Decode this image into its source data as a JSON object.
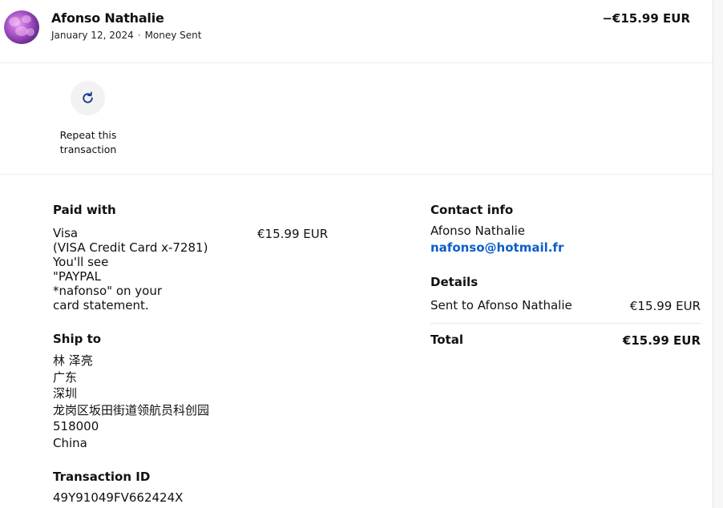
{
  "header": {
    "name": "Afonso Nathalie",
    "date": "January 12, 2024",
    "separator": "·",
    "type": "Money Sent",
    "amount": "−€15.99 EUR"
  },
  "actions": {
    "repeat_label": "Repeat this transaction",
    "repeat_icon": "refresh-icon"
  },
  "paid_with": {
    "title": "Paid with",
    "lines": [
      "Visa",
      "(VISA Credit Card x-7281)",
      "You'll see",
      "\"PAYPAL",
      "*nafonso\" on your",
      "card statement."
    ],
    "amount": "€15.99 EUR"
  },
  "ship_to": {
    "title": "Ship to",
    "lines": [
      "林 泽亮",
      "广东",
      "深圳",
      "龙岗区坂田街道领航员科创园",
      "518000",
      "China"
    ]
  },
  "transaction": {
    "title": "Transaction ID",
    "id": "49Y91049FV662424X"
  },
  "contact": {
    "title": "Contact info",
    "name": "Afonso Nathalie",
    "email": "nafonso@hotmail.fr"
  },
  "details": {
    "title": "Details",
    "sent_label": "Sent to Afonso Nathalie",
    "sent_amount": "€15.99 EUR",
    "total_label": "Total",
    "total_amount": "€15.99 EUR"
  },
  "colors": {
    "link": "#0a5ec8",
    "icon": "#1a3a8f",
    "divider": "#ececec"
  }
}
